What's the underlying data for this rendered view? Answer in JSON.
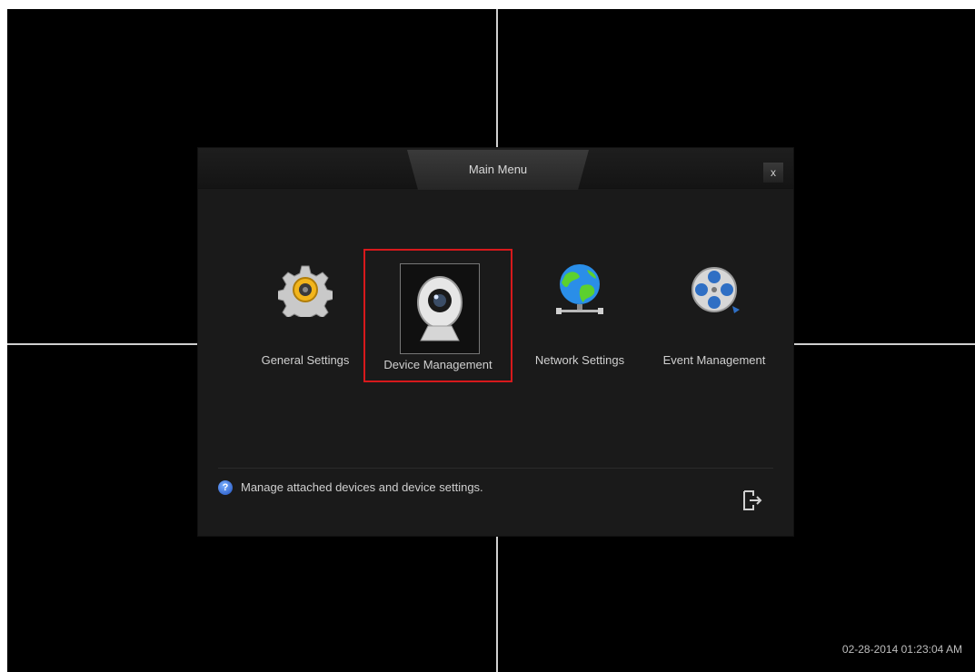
{
  "dialog": {
    "title": "Main Menu",
    "close_glyph": "x"
  },
  "menu": {
    "items": [
      {
        "label": "General Settings",
        "icon": "gear-icon"
      },
      {
        "label": "Device Management",
        "icon": "camera-icon",
        "selected": true
      },
      {
        "label": "Network Settings",
        "icon": "globe-icon"
      },
      {
        "label": "Event Management",
        "icon": "film-reel-icon"
      }
    ]
  },
  "hint": {
    "icon": "help-icon",
    "text": "Manage attached devices and device settings."
  },
  "footer": {
    "exit_icon": "exit-icon"
  },
  "status": {
    "datetime": "02-28-2014 01:23:04 AM"
  },
  "colors": {
    "selection_border": "#d7191c",
    "background": "#000000",
    "dialog_bg": "#1a1a1a"
  }
}
